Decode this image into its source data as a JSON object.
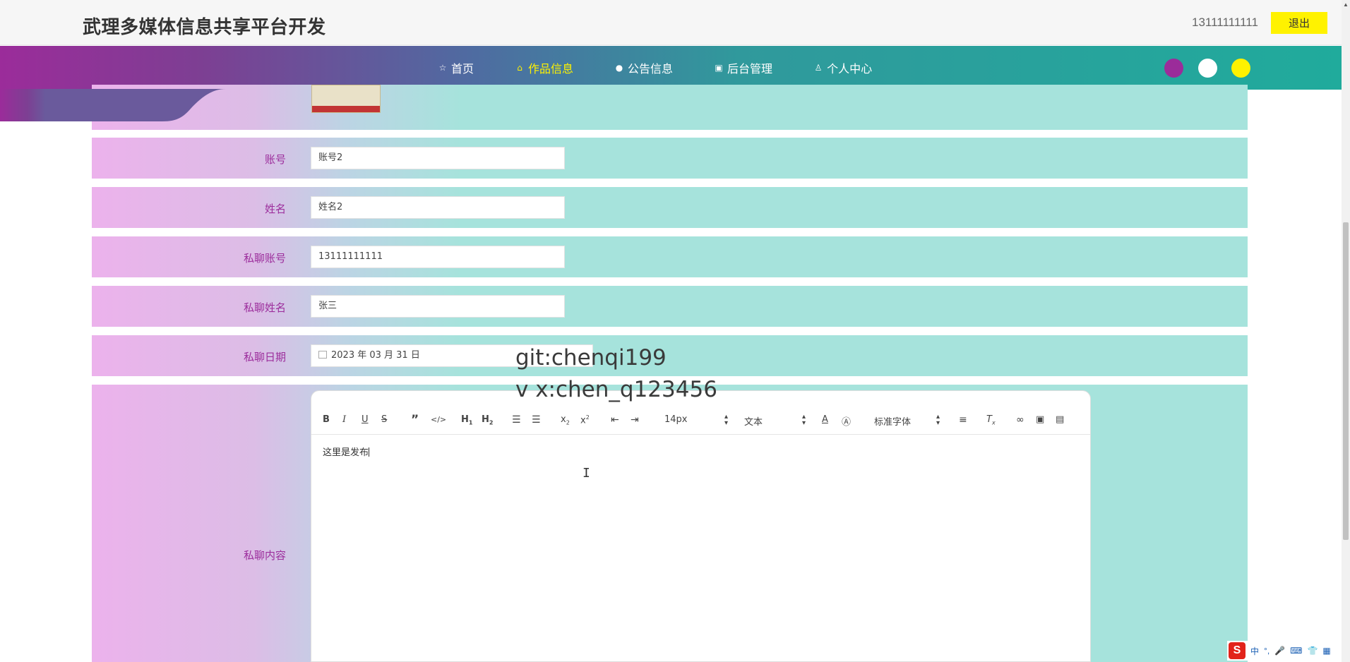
{
  "header": {
    "title": "武理多媒体信息共享平台开发",
    "account": "13111111111",
    "logout_label": "退出"
  },
  "nav": {
    "items": [
      {
        "label": "首页",
        "icon": "star-icon"
      },
      {
        "label": "作品信息",
        "icon": "bag-icon",
        "active": true
      },
      {
        "label": "公告信息",
        "icon": "info-circle-icon"
      },
      {
        "label": "后台管理",
        "icon": "archive-icon"
      },
      {
        "label": "个人中心",
        "icon": "user-icon"
      }
    ],
    "theme_colors": [
      "#9b2c9a",
      "#ffffff",
      "#fff200"
    ]
  },
  "form": {
    "account_label": "账号",
    "account_value": "账号2",
    "name_label": "姓名",
    "name_value": "姓名2",
    "chat_account_label": "私聊账号",
    "chat_account_value": "13111111111",
    "chat_name_label": "私聊姓名",
    "chat_name_value": "张三",
    "chat_date_label": "私聊日期",
    "chat_date_value": "2023 年 03 月 31 日",
    "chat_content_label": "私聊内容"
  },
  "editor": {
    "font_size": "14px",
    "block_type": "文本",
    "font_family": "标准字体",
    "content": "这里是发布"
  },
  "watermark": {
    "line1": "git:chenqi199",
    "line2": "v x:chen_q123456"
  },
  "ime": {
    "logo": "S",
    "items": [
      "中",
      "°,",
      "🎤",
      "⌨",
      "👕",
      "▦"
    ]
  }
}
